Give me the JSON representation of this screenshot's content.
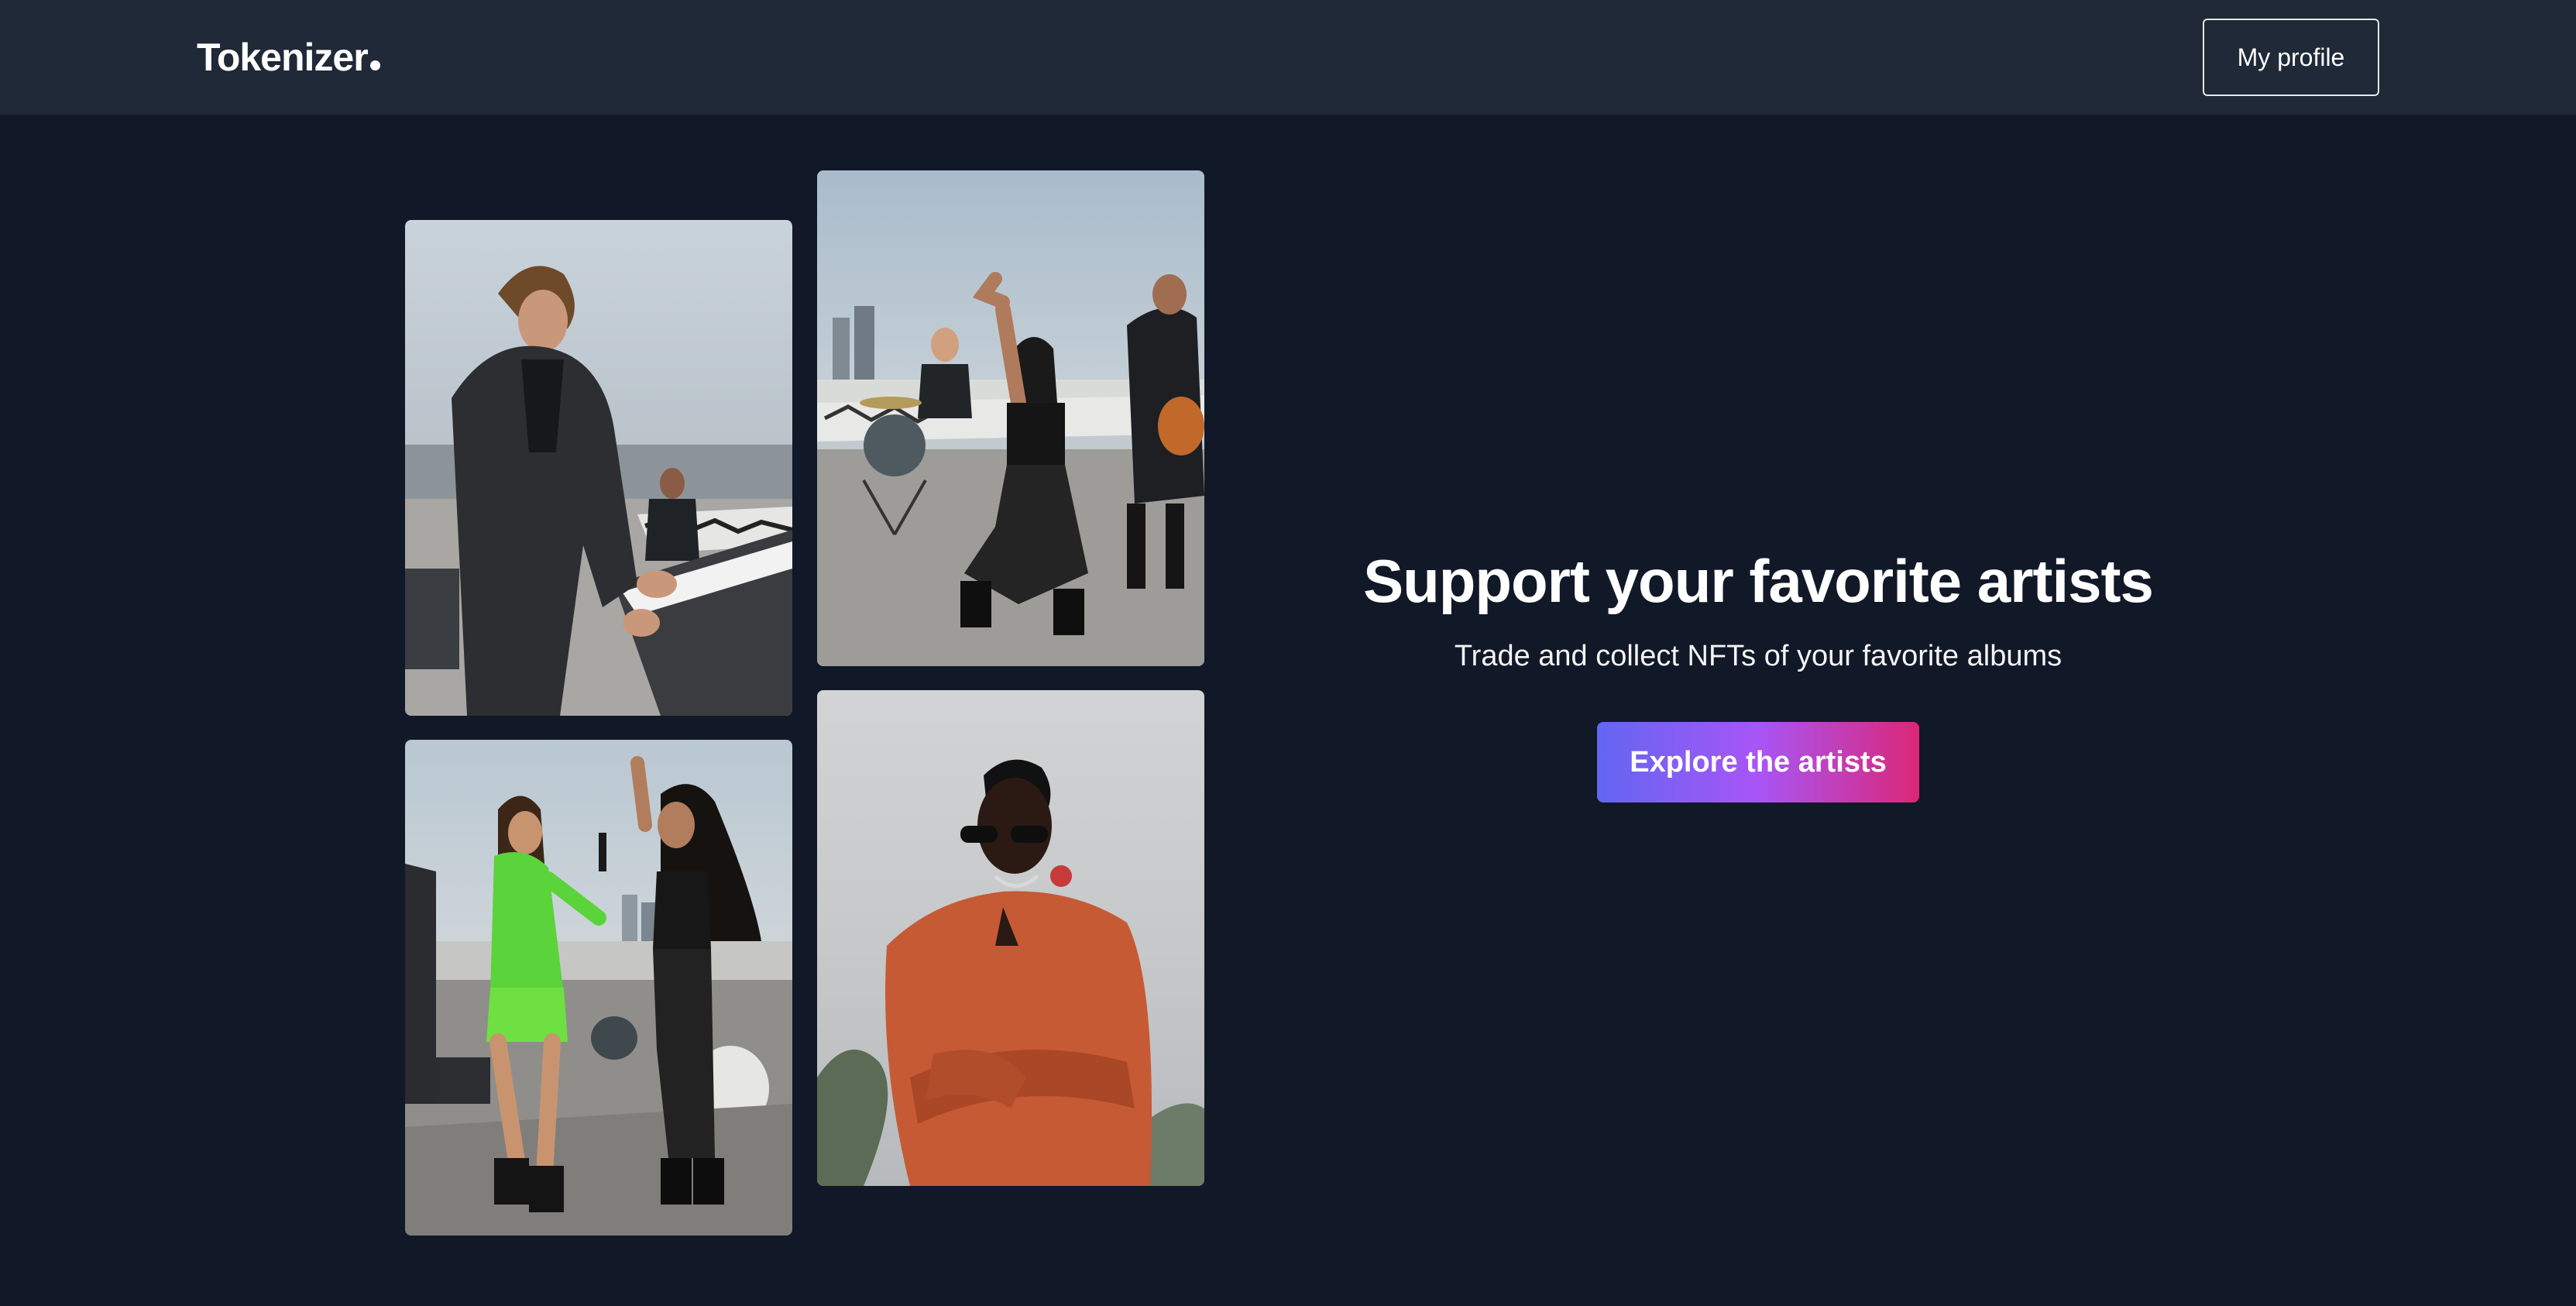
{
  "navbar": {
    "logo": "Tokenizer",
    "profile_button": "My profile"
  },
  "hero": {
    "title": "Support your favorite artists",
    "subtitle": "Trade and collect NFTs of your favorite albums",
    "cta": "Explore the artists"
  },
  "gallery": {
    "photos": [
      "photo-pianist",
      "photo-singer-rooftop",
      "photo-two-singers",
      "photo-orange-shirt-artist"
    ]
  },
  "colors": {
    "background": "#111827",
    "navbar": "#1f2937",
    "cta_gradient_start": "#6366f1",
    "cta_gradient_end": "#db2777"
  }
}
